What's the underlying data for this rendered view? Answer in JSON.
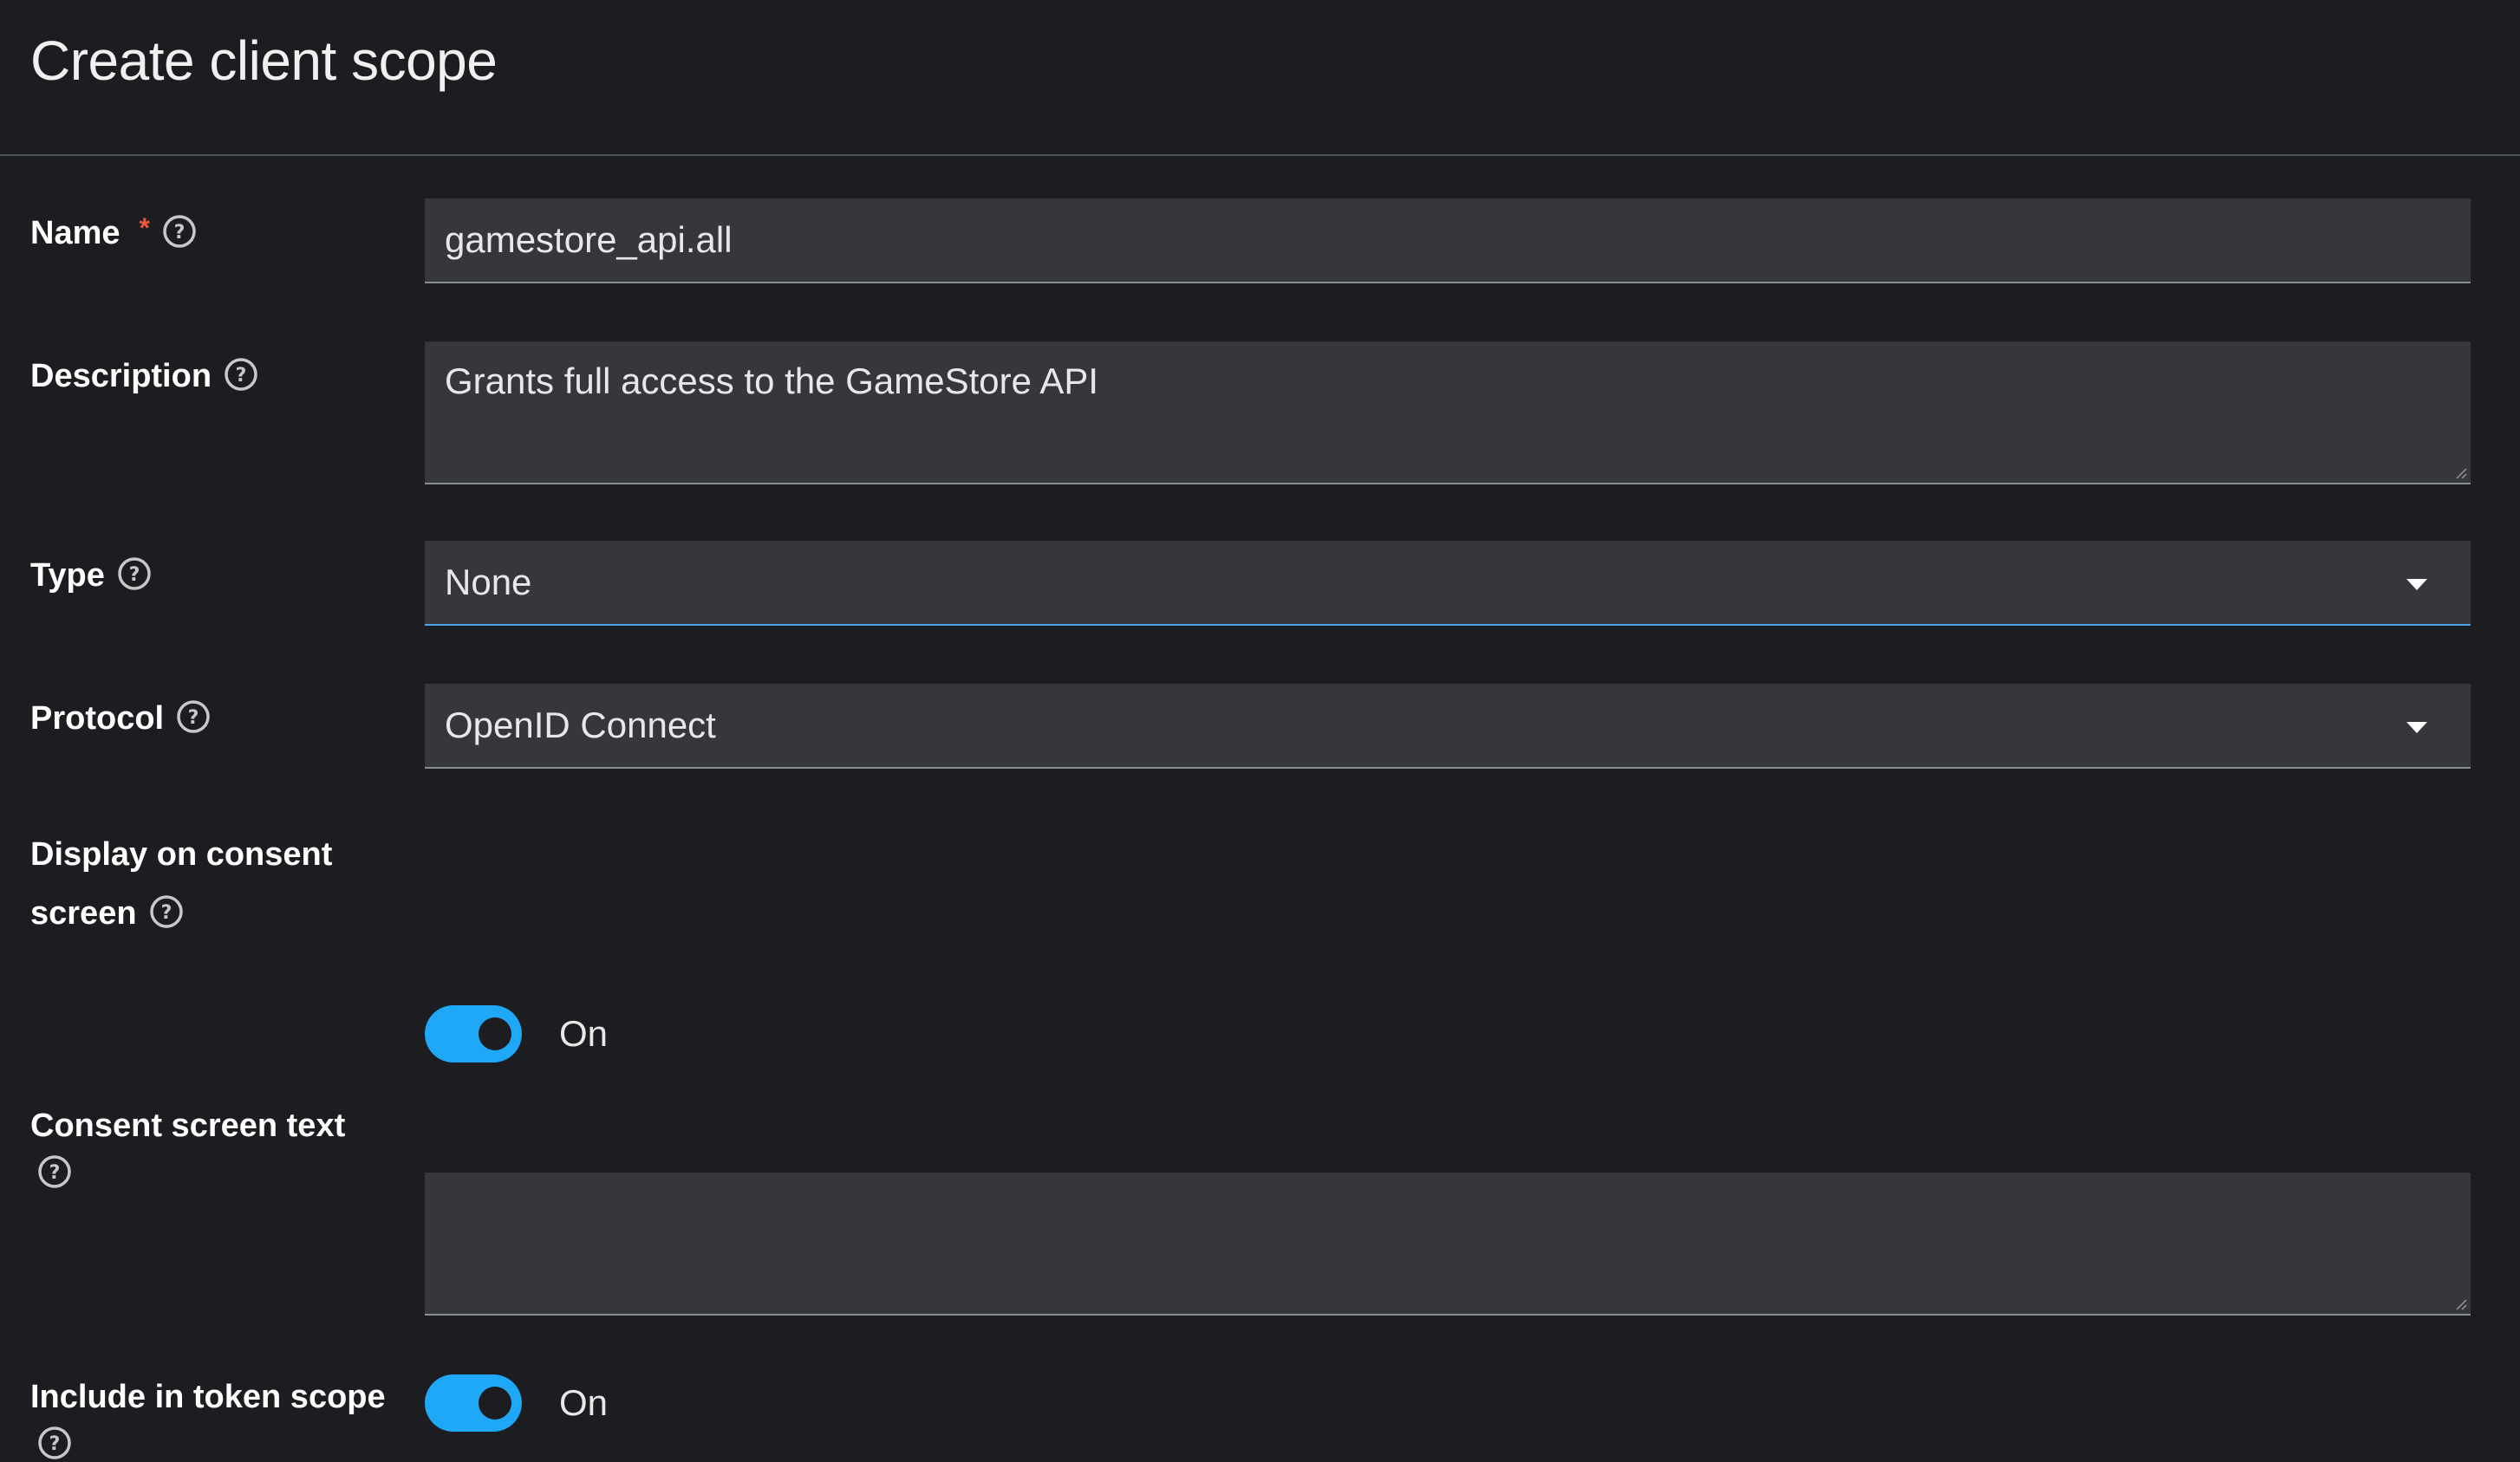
{
  "page": {
    "title": "Create client scope"
  },
  "form": {
    "name": {
      "label": "Name",
      "required_marker": "*",
      "value": "gamestore_api.all"
    },
    "description": {
      "label": "Description",
      "value": "Grants full access to the GameStore API"
    },
    "type": {
      "label": "Type",
      "selected": "None"
    },
    "protocol": {
      "label": "Protocol",
      "selected": "OpenID Connect"
    },
    "display_on_consent": {
      "label_line1": "Display on consent",
      "label_line2": "screen",
      "state_label": "On",
      "checked": true
    },
    "consent_screen_text": {
      "label": "Consent screen text",
      "value": ""
    },
    "include_in_token_scope": {
      "label": "Include in token scope",
      "state_label": "On",
      "checked": true
    }
  },
  "icons": {
    "help": "help-circle-icon",
    "dropdown": "caret-down-icon"
  },
  "colors": {
    "background": "#1b1d21",
    "field_background": "#36373c",
    "toggle_on": "#1fa7f8",
    "required": "#f0553a",
    "active_border": "#4ba3e8"
  }
}
